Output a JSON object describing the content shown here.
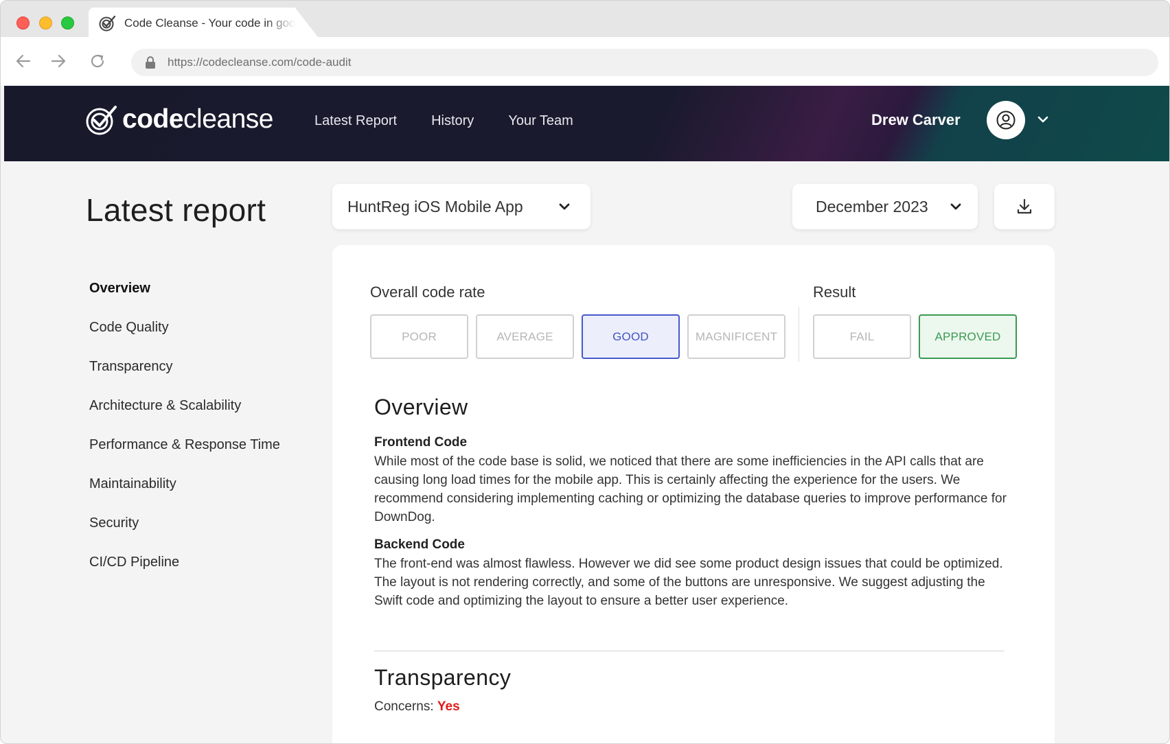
{
  "browser": {
    "tab_title": "Code Cleanse - Your code in good hands",
    "url": "https://codecleanse.com/code-audit"
  },
  "header": {
    "logo_bold": "code",
    "logo_light": "cleanse",
    "nav": [
      "Latest Report",
      "History",
      "Your Team"
    ],
    "user_name": "Drew Carver"
  },
  "page": {
    "title": "Latest report",
    "project": "HuntReg iOS Mobile App",
    "month": "December 2023"
  },
  "sidebar": {
    "items": [
      {
        "label": "Overview",
        "active": true
      },
      {
        "label": "Code Quality"
      },
      {
        "label": "Transparency"
      },
      {
        "label": "Architecture & Scalability"
      },
      {
        "label": "Performance & Response Time"
      },
      {
        "label": "Maintainability"
      },
      {
        "label": "Security"
      },
      {
        "label": "CI/CD Pipeline"
      }
    ]
  },
  "rating": {
    "label": "Overall code rate",
    "options": [
      "POOR",
      "AVERAGE",
      "GOOD",
      "MAGNIFICENT"
    ],
    "selected": "GOOD",
    "result_label": "Result",
    "result_options": [
      "FAIL",
      "APPROVED"
    ],
    "result_selected": "APPROVED"
  },
  "overview": {
    "title": "Overview",
    "frontend_title": "Frontend Code",
    "frontend_text": "While most of the code base is solid, we noticed that there are some inefficiencies in the API calls that are causing long load times for the mobile app. This is certainly affecting the experience for the users. We recommend considering implementing caching or optimizing the database queries to improve performance for DownDog.",
    "backend_title": "Backend Code",
    "backend_text": "The front-end was almost flawless. However we did see some product design issues that could be optimized. The layout is not rendering correctly, and some of the buttons are unresponsive. We suggest adjusting the Swift code and optimizing the layout to ensure a better user experience."
  },
  "transparency": {
    "title": "Transparency",
    "concerns_label": "Concerns:",
    "concerns_value": "Yes"
  },
  "colors": {
    "header_bg": "#1a1a2e",
    "selected_blue": "#4254c2",
    "selected_green": "#3a9a52",
    "concern_red": "#e01a1a"
  },
  "icons": [
    "codecleanse-logo-icon",
    "back-arrow-icon",
    "forward-arrow-icon",
    "reload-icon",
    "lock-icon",
    "user-icon",
    "chevron-down-icon",
    "download-icon"
  ]
}
